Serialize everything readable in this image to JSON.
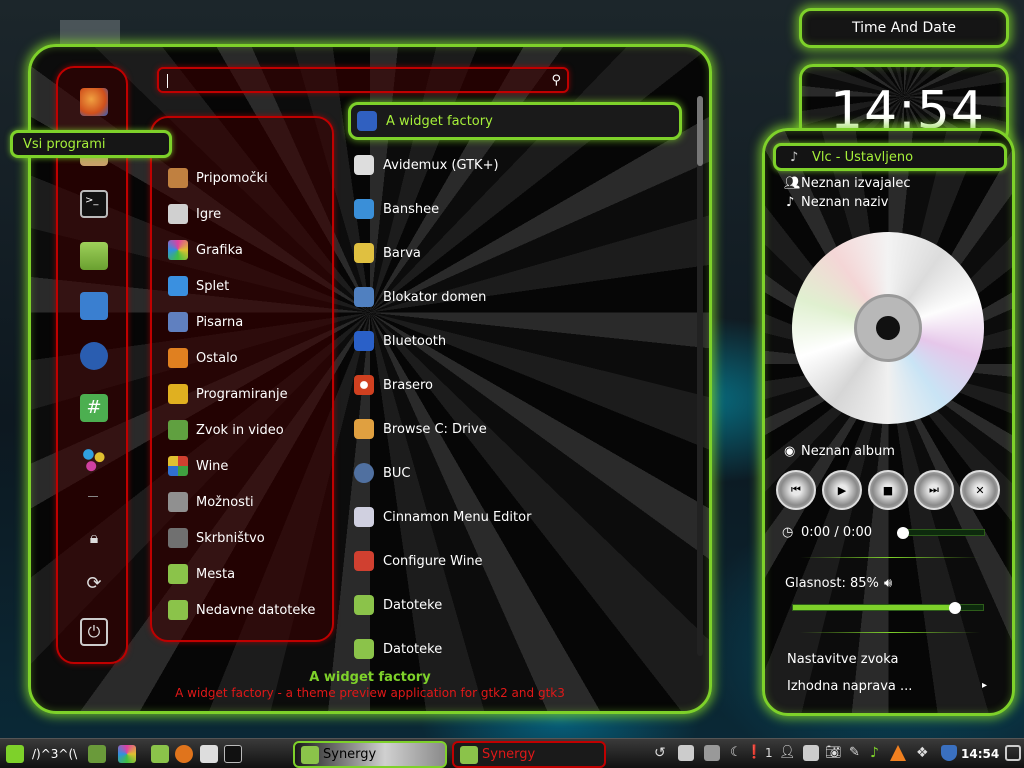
{
  "menu": {
    "search": {
      "placeholder": ""
    },
    "favorites": [
      {
        "name": "firefox-icon",
        "color": "#e8741c"
      },
      {
        "name": "package-icon",
        "color": "#c9a06a"
      },
      {
        "name": "terminal-icon",
        "color": "#222222"
      },
      {
        "name": "folder-icon",
        "color": "#8bc34a"
      },
      {
        "name": "pidgin-icon",
        "color": "#3a7fd0"
      },
      {
        "name": "chat-icon",
        "color": "#2a5db0"
      },
      {
        "name": "hash-icon",
        "color": "#4caf50"
      },
      {
        "name": "dots-icon",
        "color": "#d0a030"
      }
    ],
    "session": [
      {
        "name": "lock-icon"
      },
      {
        "name": "logout-icon"
      },
      {
        "name": "power-icon"
      }
    ],
    "categories": [
      {
        "label": "Vsi programi",
        "icon": "all-icon",
        "color": "#7ed12a"
      },
      {
        "label": "Pripomočki",
        "icon": "calculator-icon",
        "color": "#c08040"
      },
      {
        "label": "Igre",
        "icon": "games-icon",
        "color": "#d0d0d0"
      },
      {
        "label": "Grafika",
        "icon": "graphics-icon",
        "color": "#e040a0"
      },
      {
        "label": "Splet",
        "icon": "internet-icon",
        "color": "#3a90e0"
      },
      {
        "label": "Pisarna",
        "icon": "office-icon",
        "color": "#6080c0"
      },
      {
        "label": "Ostalo",
        "icon": "other-icon",
        "color": "#e08020"
      },
      {
        "label": "Programiranje",
        "icon": "programming-icon",
        "color": "#e0b020"
      },
      {
        "label": "Zvok in video",
        "icon": "multimedia-icon",
        "color": "#60a040"
      },
      {
        "label": "Wine",
        "icon": "wine-icon",
        "color": "#d04030"
      },
      {
        "label": "Možnosti",
        "icon": "preferences-icon",
        "color": "#909090"
      },
      {
        "label": "Skrbništvo",
        "icon": "administration-icon",
        "color": "#707070"
      },
      {
        "label": "Mesta",
        "icon": "places-icon",
        "color": "#8bc34a"
      },
      {
        "label": "Nedavne datoteke",
        "icon": "recent-icon",
        "color": "#8bc34a"
      }
    ],
    "apps": [
      {
        "label": "A widget factory",
        "icon": "widget-factory-icon",
        "color": "#3060c0"
      },
      {
        "label": "Avidemux (GTK+)",
        "icon": "avidemux-icon",
        "color": "#404040"
      },
      {
        "label": "Banshee",
        "icon": "banshee-icon",
        "color": "#3a8fd8"
      },
      {
        "label": "Barva",
        "icon": "barva-icon",
        "color": "#e0c040"
      },
      {
        "label": "Blokator domen",
        "icon": "blocker-icon",
        "color": "#5080c0"
      },
      {
        "label": "Bluetooth",
        "icon": "bluetooth-icon",
        "color": "#2a60c8"
      },
      {
        "label": "Brasero",
        "icon": "brasero-icon",
        "color": "#d04020"
      },
      {
        "label": "Browse C: Drive",
        "icon": "drive-icon",
        "color": "#e0a040"
      },
      {
        "label": "BUC",
        "icon": "buc-icon",
        "color": "#5070a0"
      },
      {
        "label": "Cinnamon Menu Editor",
        "icon": "menu-editor-icon",
        "color": "#d0d0e0"
      },
      {
        "label": "Configure Wine",
        "icon": "wine-config-icon",
        "color": "#d04030"
      },
      {
        "label": "Datoteke",
        "icon": "files-icon",
        "color": "#8bc34a"
      },
      {
        "label": "Datoteke",
        "icon": "files-icon",
        "color": "#8bc34a"
      }
    ],
    "selected_title": "A widget factory",
    "selected_desc": "A widget factory - a theme preview application for gtk2 and gtk3"
  },
  "desklets": {
    "time_and_date": "Time And Date",
    "clock": "14:54"
  },
  "sound": {
    "header": "Vlc - Ustavljeno",
    "artist": "Neznan izvajalec",
    "title": "Neznan naziv",
    "album": "Neznan album",
    "position": "0:00 / 0:00",
    "position_fraction": 0.0,
    "volume_label": "Glasnost: 85%",
    "volume_fraction": 0.85,
    "settings": "Nastavitve zvoka",
    "output_device": "Izhodna naprava ...",
    "output_arrow": "▸",
    "controls": [
      {
        "name": "previous-icon",
        "glyph": "⏮"
      },
      {
        "name": "play-icon",
        "glyph": "▶"
      },
      {
        "name": "stop-icon",
        "glyph": "■"
      },
      {
        "name": "next-icon",
        "glyph": "⏭"
      },
      {
        "name": "close-icon",
        "glyph": "✕"
      }
    ]
  },
  "taskbar": {
    "workspace_label": "/)^3^(\\",
    "windows": [
      {
        "label": "Synergy",
        "state": "active"
      },
      {
        "label": "Synergy",
        "state": "attention"
      }
    ],
    "tray_counter": "1",
    "time": "14:54"
  }
}
